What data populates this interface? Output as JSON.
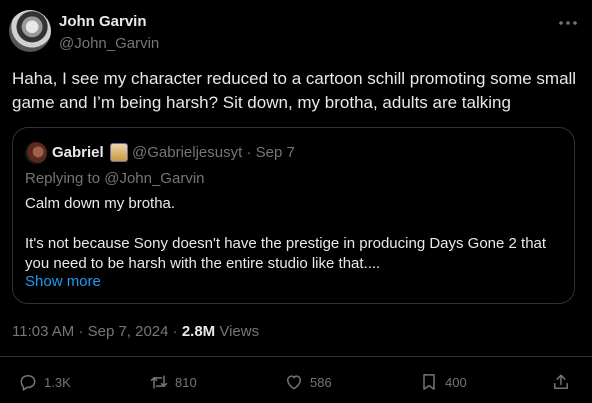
{
  "author": {
    "name": "John Garvin",
    "handle": "@John_Garvin"
  },
  "post": {
    "text": "Haha, I see my character reduced to a cartoon schill promoting some small game and I’m being harsh? Sit down, my brotha, adults are talking"
  },
  "quote": {
    "name": "Gabriel",
    "handle_date": "@Gabrieljesusyt · Sep 7",
    "replying_to": "Replying to @John_Garvin",
    "body": "Calm down my brotha.\n\nIt's not because Sony doesn't have the prestige in producing Days Gone 2 that you need to be harsh with the entire studio like that....",
    "show_more": "Show more"
  },
  "meta": {
    "time_date": "11:03 AM · Sep 7, 2024 · ",
    "views_count": "2.8M",
    "views_label": " Views"
  },
  "actions": {
    "replies": "1.3K",
    "reposts": "810",
    "likes": "586",
    "bookmarks": "400"
  },
  "icons": {
    "more": "more-icon",
    "reply": "reply-icon",
    "repost": "repost-icon",
    "like": "heart-icon",
    "bookmark": "bookmark-icon",
    "share": "share-icon"
  },
  "colors": {
    "background": "#000000",
    "text": "#e7e9ea",
    "muted": "#71767b",
    "link": "#1d9bf0",
    "border": "#2f3336"
  }
}
